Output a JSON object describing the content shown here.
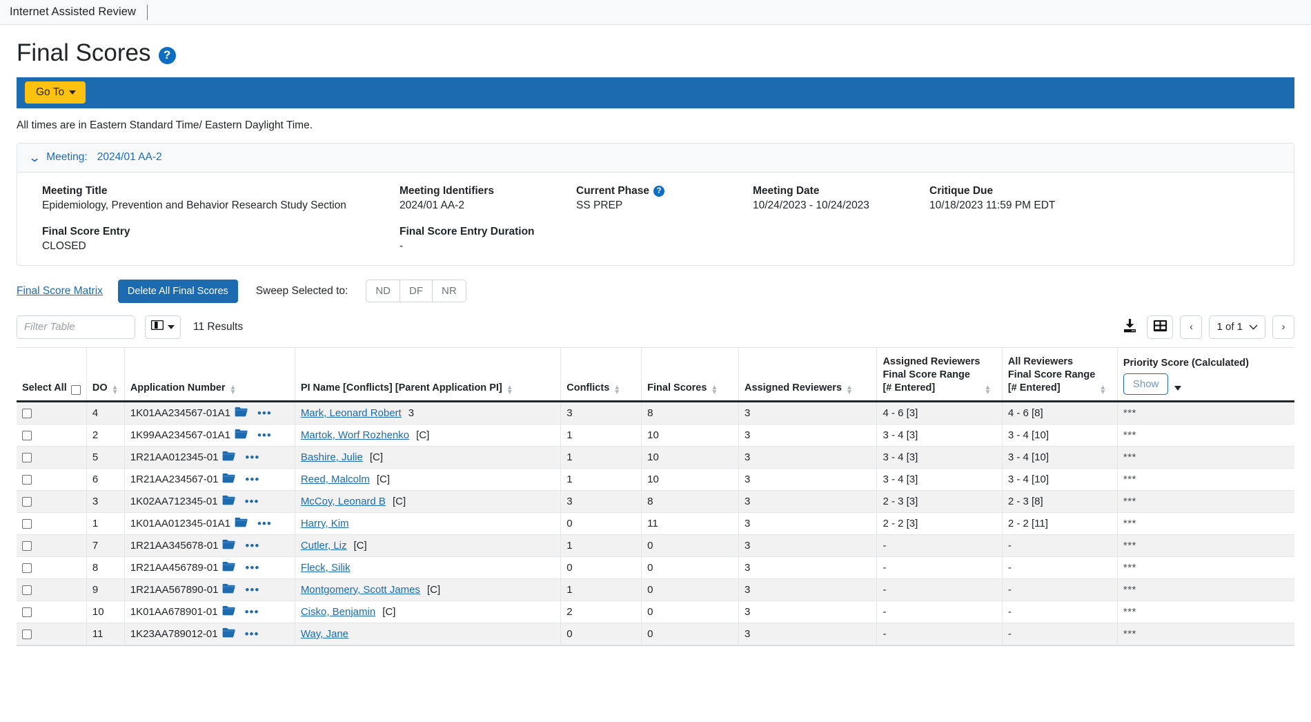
{
  "appbar": {
    "title": "Internet Assisted Review"
  },
  "page": {
    "title": "Final Scores",
    "help_icon": "help-circle-icon"
  },
  "nav": {
    "goto_label": "Go To"
  },
  "notice": {
    "times_note": "All times are in Eastern Standard Time/ Eastern Daylight Time."
  },
  "meeting_panel": {
    "header_label": "Meeting:",
    "header_value": "2024/01 AA-2",
    "fields": {
      "meeting_title_label": "Meeting Title",
      "meeting_title_value": "Epidemiology, Prevention and Behavior Research Study Section",
      "meeting_identifiers_label": "Meeting Identifiers",
      "meeting_identifiers_value": "2024/01 AA-2",
      "current_phase_label": "Current Phase",
      "current_phase_value": "SS PREP",
      "meeting_date_label": "Meeting Date",
      "meeting_date_value": "10/24/2023 - 10/24/2023",
      "critique_due_label": "Critique Due",
      "critique_due_value": "10/18/2023 11:59 PM EDT",
      "final_score_entry_label": "Final Score Entry",
      "final_score_entry_value": "CLOSED",
      "final_score_entry_duration_label": "Final Score Entry Duration",
      "final_score_entry_duration_value": "-"
    }
  },
  "actions": {
    "final_score_matrix_link": "Final Score Matrix",
    "delete_all_label": "Delete All Final Scores",
    "sweep_label": "Sweep Selected to:",
    "sweep_buttons": [
      "ND",
      "DF",
      "NR"
    ]
  },
  "toolbar": {
    "filter_placeholder": "Filter Table",
    "filter_value": "",
    "column_toggle_icon": "columns-icon",
    "results_count": "11 Results",
    "download_icon": "download-icon",
    "grid_view_icon": "grid-view-icon",
    "prev_label": "‹",
    "next_label": "›",
    "page_indicator": "1 of 1"
  },
  "table": {
    "headers": {
      "select_all": "Select All",
      "do": "DO",
      "application_number": "Application Number",
      "pi_name": "PI Name [Conflicts] [Parent Application PI]",
      "conflicts": "Conflicts",
      "final_scores": "Final Scores",
      "assigned_reviewers": "Assigned Reviewers",
      "assigned_range_l1": "Assigned Reviewers",
      "assigned_range_l2": "Final Score Range",
      "assigned_range_l3": "[# Entered]",
      "all_range_l1": "All Reviewers",
      "all_range_l2": "Final Score Range",
      "all_range_l3": "[# Entered]",
      "priority_score": "Priority Score (Calculated)",
      "show_label": "Show"
    },
    "rows": [
      {
        "do": "4",
        "app": "1K01AA234567-01A1",
        "pi": "Mark, Leonard Robert",
        "tag": "3",
        "conflicts": "3",
        "final_scores": "8",
        "assigned_reviewers": "3",
        "assigned_range": "4 - 6 [3]",
        "all_range": "4 - 6 [8]",
        "priority": "***"
      },
      {
        "do": "2",
        "app": "1K99AA234567-01A1",
        "pi": "Martok, Worf Rozhenko",
        "tag": "[C]",
        "conflicts": "1",
        "final_scores": "10",
        "assigned_reviewers": "3",
        "assigned_range": "3 - 4 [3]",
        "all_range": "3 - 4 [10]",
        "priority": "***"
      },
      {
        "do": "5",
        "app": "1R21AA012345-01",
        "pi": "Bashire, Julie",
        "tag": "[C]",
        "conflicts": "1",
        "final_scores": "10",
        "assigned_reviewers": "3",
        "assigned_range": "3 - 4 [3]",
        "all_range": "3 - 4 [10]",
        "priority": "***"
      },
      {
        "do": "6",
        "app": "1R21AA234567-01",
        "pi": "Reed, Malcolm",
        "tag": "[C]",
        "conflicts": "1",
        "final_scores": "10",
        "assigned_reviewers": "3",
        "assigned_range": "3 - 4 [3]",
        "all_range": "3 - 4 [10]",
        "priority": "***"
      },
      {
        "do": "3",
        "app": "1K02AA712345-01",
        "pi": "McCoy, Leonard B",
        "tag": "[C]",
        "conflicts": "3",
        "final_scores": "8",
        "assigned_reviewers": "3",
        "assigned_range": "2 - 3 [3]",
        "all_range": "2 - 3 [8]",
        "priority": "***"
      },
      {
        "do": "1",
        "app": "1K01AA012345-01A1",
        "pi": "Harry, Kim",
        "tag": "",
        "conflicts": "0",
        "final_scores": "11",
        "assigned_reviewers": "3",
        "assigned_range": "2 - 2 [3]",
        "all_range": "2 - 2 [11]",
        "priority": "***"
      },
      {
        "do": "7",
        "app": "1R21AA345678-01",
        "pi": "Cutler, Liz",
        "tag": "[C]",
        "conflicts": "1",
        "final_scores": "0",
        "assigned_reviewers": "3",
        "assigned_range": "-",
        "all_range": "-",
        "priority": "***"
      },
      {
        "do": "8",
        "app": "1R21AA456789-01",
        "pi": "Fleck, Silik",
        "tag": "",
        "conflicts": "0",
        "final_scores": "0",
        "assigned_reviewers": "3",
        "assigned_range": "-",
        "all_range": "-",
        "priority": "***"
      },
      {
        "do": "9",
        "app": "1R21AA567890-01",
        "pi": "Montgomery, Scott James",
        "tag": "[C]",
        "conflicts": "1",
        "final_scores": "0",
        "assigned_reviewers": "3",
        "assigned_range": "-",
        "all_range": "-",
        "priority": "***"
      },
      {
        "do": "10",
        "app": "1K01AA678901-01",
        "pi": "Cisko, Benjamin",
        "tag": "[C]",
        "conflicts": "2",
        "final_scores": "0",
        "assigned_reviewers": "3",
        "assigned_range": "-",
        "all_range": "-",
        "priority": "***"
      },
      {
        "do": "11",
        "app": "1K23AA789012-01",
        "pi": "Way, Jane",
        "tag": "",
        "conflicts": "0",
        "final_scores": "0",
        "assigned_reviewers": "3",
        "assigned_range": "-",
        "all_range": "-",
        "priority": "***"
      }
    ]
  },
  "colors": {
    "brand_blue": "#1c6bb0",
    "accent_yellow": "#fcc20f",
    "link_blue": "#1c6bb0",
    "panel_gray": "#f8f9fa",
    "row_stripe": "#f2f2f2"
  }
}
